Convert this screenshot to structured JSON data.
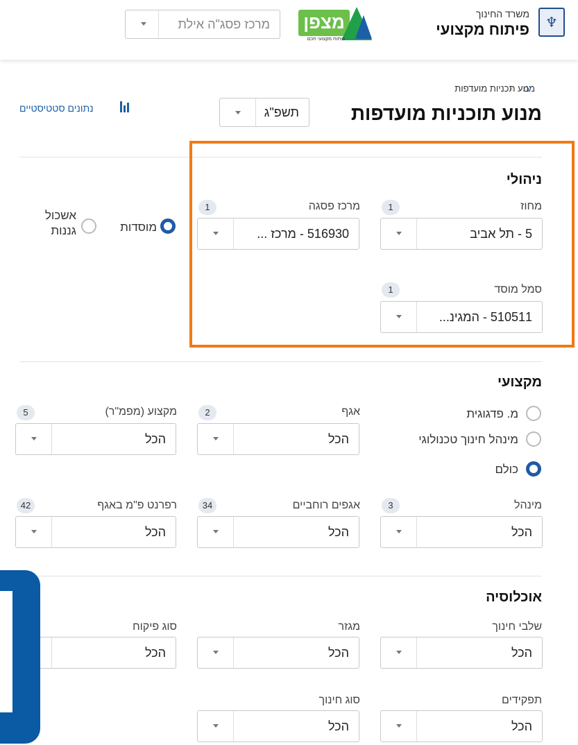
{
  "header": {
    "ministry_small": "משרד החינוך",
    "ministry_big": "פיתוח מקצועי",
    "logo_text": "מצפן",
    "logo_sub": "פיתוח מקצועי חכם",
    "center_select": "מרכז פסג\"ה אילת"
  },
  "breadcrumb": {
    "current": "מנוע תכניות מועדפות"
  },
  "page": {
    "title": "מנוע תוכניות מועדפות",
    "year": "תשפ\"ג",
    "stats_link": "נתונים סטטיסטיים"
  },
  "admin": {
    "title": "ניהולי",
    "district": {
      "label": "מחוז",
      "count": "1",
      "value": "5 - תל אביב"
    },
    "center": {
      "label": "מרכז פסגה",
      "count": "1",
      "value": "516930 - מרכז ..."
    },
    "institution_code": {
      "label": "סמל מוסד",
      "count": "1",
      "value": "510511 - המגינ..."
    },
    "radio_institutions": "מוסדות",
    "radio_kindergartens": "אשכול גננות"
  },
  "professional": {
    "title": "מקצועי",
    "radio_pedagogic": "מ. פדגוגית",
    "radio_tech": "מינהל חינוך טכנולוגי",
    "radio_all": "כולם",
    "wing": {
      "label": "אגף",
      "count": "2",
      "value": "הכל"
    },
    "subject": {
      "label": "מקצוע (מפמ\"ר)",
      "count": "5",
      "value": "הכל"
    },
    "administration": {
      "label": "מינהל",
      "count": "3",
      "value": "הכל"
    },
    "wide_wings": {
      "label": "אגפים רוחביים",
      "count": "34",
      "value": "הכל"
    },
    "referent": {
      "label": "רפרנט פ\"מ באגף",
      "count": "42",
      "value": "הכל"
    }
  },
  "population": {
    "title": "אוכלוסיה",
    "stages": {
      "label": "שלבי חינוך",
      "value": "הכל"
    },
    "sector": {
      "label": "מגזר",
      "value": "הכל"
    },
    "supervision": {
      "label": "סוג פיקוח",
      "value": "הכל"
    },
    "roles": {
      "label": "תפקידים",
      "value": "הכל"
    },
    "education_type": {
      "label": "סוג חינוך",
      "value": "הכל"
    }
  },
  "colors": {
    "accent": "#1f5aa6",
    "highlight": "#f07a14",
    "overlay": "#0a5aa4"
  }
}
